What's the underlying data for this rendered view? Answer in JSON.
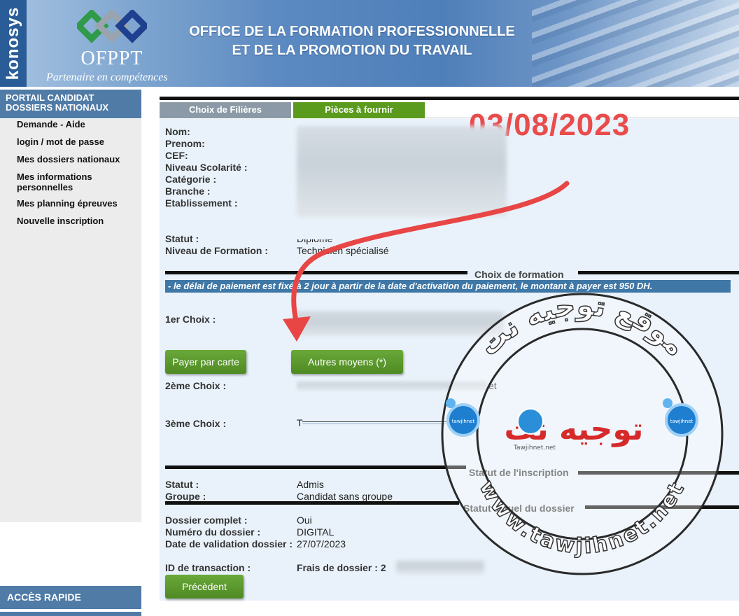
{
  "banner": {
    "brand_vertical": "konosys",
    "logo_name": "OFPPT",
    "logo_tagline": "Partenaire en compétences",
    "title_line1": "OFFICE DE LA FORMATION PROFESSIONNELLE",
    "title_line2": "ET DE LA PROMOTION DU TRAVAIL"
  },
  "sidebar": {
    "header": "PORTAIL CANDIDAT DOSSIERS NATIONAUX",
    "items": [
      {
        "label": "Demande - Aide"
      },
      {
        "label": "login / mot de passe"
      },
      {
        "label": "Mes dossiers nationaux"
      },
      {
        "label": "Mes informations personnelles"
      },
      {
        "label": "Mes planning épreuves"
      },
      {
        "label": "Nouvelle inscription"
      }
    ],
    "quick_access": "ACCÈS RAPIDE"
  },
  "tabs": [
    {
      "label": "Choix de Filières",
      "active": false
    },
    {
      "label": "Pièces à fournir",
      "active": true
    }
  ],
  "date_stamp": "03/08/2023",
  "profile": {
    "fields": [
      {
        "label": "Nom:"
      },
      {
        "label": "Prenom:"
      },
      {
        "label": "CEF:"
      },
      {
        "label": "Niveau Scolarité :"
      },
      {
        "label": "Catégorie :"
      },
      {
        "label": "Branche :"
      },
      {
        "label": "Etablissement :"
      }
    ],
    "statut_label": "Statut :",
    "statut_value": "Diplomé",
    "niveau_label": "Niveau de Formation :",
    "niveau_value": "Technicien spécialisé"
  },
  "formation": {
    "section_title": "Choix de formation",
    "notice": "- le délai de paiement est fixé à 2 jour à partir de la date d'activation du paiement, le montant à payer est 950 DH.",
    "choice1_label": "1er Choix :",
    "pay_card_button": "Payer par carte",
    "other_means_button": "Autres moyens (*)",
    "choice2_label": "2ème Choix :",
    "choice2_value": "et",
    "choice3_label": "3ème Choix :",
    "choice3_value": "T"
  },
  "inscription": {
    "section_title": "Statut de l'inscription",
    "statut_label": "Statut :",
    "statut_value": "Admis",
    "groupe_label": "Groupe :",
    "groupe_value": "Candidat sans groupe"
  },
  "dossier": {
    "section_title": "Statut actuel du dossier",
    "complet_label": "Dossier complet :",
    "complet_value": "Oui",
    "numero_label": "Numéro du dossier :",
    "numero_value": "DIGITAL",
    "validation_label": "Date de validation dossier :",
    "validation_value": "27/07/2023",
    "transaction_label": "ID de transaction :",
    "frais_label": "Frais de dossier : 2",
    "prev_button": "Précèdent"
  },
  "watermark": {
    "arabic_top": "موقع توجيه نت",
    "latin_ring": "www.tawjihnet.net",
    "center_text": "توجيه نت",
    "badge_text": "tawjihnet",
    "center_small": "Tawjihnet.net"
  },
  "colors": {
    "banner_blue": "#4f7fb9",
    "sidebar_blue": "#4f7ba6",
    "tab_active_green": "#5a9a1c",
    "tab_inactive_gray": "#8b9aa6",
    "button_green": "#5a9a2a",
    "notice_blue": "#3f77a6",
    "date_red": "#ea4b4b",
    "panel_bg": "#e9f2fa"
  }
}
